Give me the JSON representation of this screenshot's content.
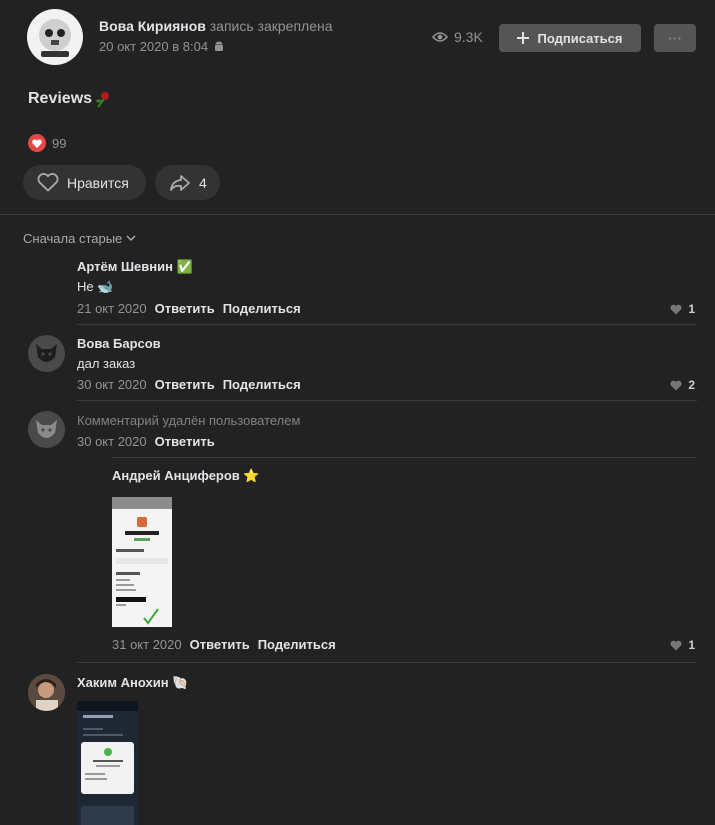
{
  "post": {
    "author": "Вова Кириянов",
    "pinned_note": "запись закреплена",
    "date": "20 окт 2020 в 8:04",
    "views": "9.3K",
    "subscribe_label": "Подписаться",
    "more_label": "···",
    "text": "Reviews",
    "reactions_count": "99",
    "like_label": "Нравится",
    "share_count": "4"
  },
  "comments": {
    "sort_label": "Сначала старые",
    "items": [
      {
        "name": "Артём Шевнин ✅",
        "text": "Не 🐋",
        "date": "21 окт 2020",
        "reply": "Ответить",
        "share": "Поделиться",
        "likes": "1"
      },
      {
        "name": "Вова Барсов",
        "text": "дал заказ",
        "date": "30 окт 2020",
        "reply": "Ответить",
        "share": "Поделиться",
        "likes": "2"
      },
      {
        "deleted": "Комментарий удалён пользователем",
        "date": "30 окт 2020",
        "reply": "Ответить"
      },
      {
        "name": "Андрей Анциферов ⭐",
        "date": "31 окт 2020",
        "reply": "Ответить",
        "share": "Поделиться",
        "likes": "1"
      },
      {
        "name": "Хаким Анохин 🐚"
      }
    ]
  },
  "colors": {
    "background": "#222222",
    "button": "#555555",
    "heart": "#e64646"
  }
}
